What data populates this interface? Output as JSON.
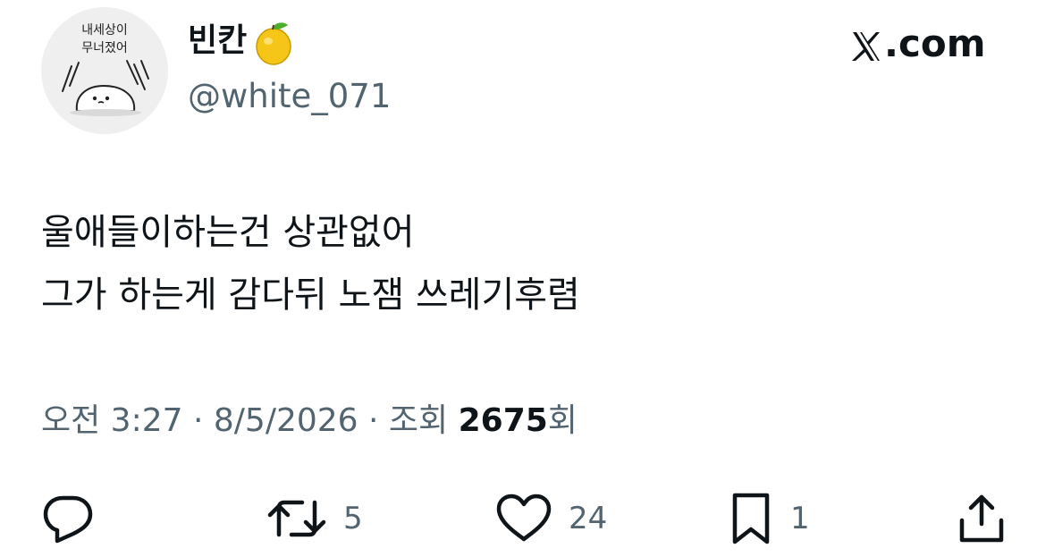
{
  "author": {
    "display_name": "빈칸",
    "name_emoji": "lemon-icon",
    "handle": "@white_071",
    "avatar_text_line1": "내세상이",
    "avatar_text_line2": "무너졌어"
  },
  "brand": {
    "logo_text": ".com",
    "logo_mark": "x-logo-icon"
  },
  "tweet": {
    "lines": [
      "울애들이하는건 상관없어",
      "그가 하는게 감다뒤 노잼 쓰레기후렴"
    ]
  },
  "meta": {
    "time": "오전 3:27",
    "separator": " · ",
    "date": "8/5/2026",
    "views_prefix": "조회 ",
    "views_count": "2675",
    "views_suffix": "회"
  },
  "actions": {
    "reply_count": "",
    "retweet_count": "5",
    "like_count": "24",
    "bookmark_count": "1"
  },
  "colors": {
    "text_primary": "#0f1419",
    "text_secondary": "#536471",
    "background": "#ffffff"
  }
}
